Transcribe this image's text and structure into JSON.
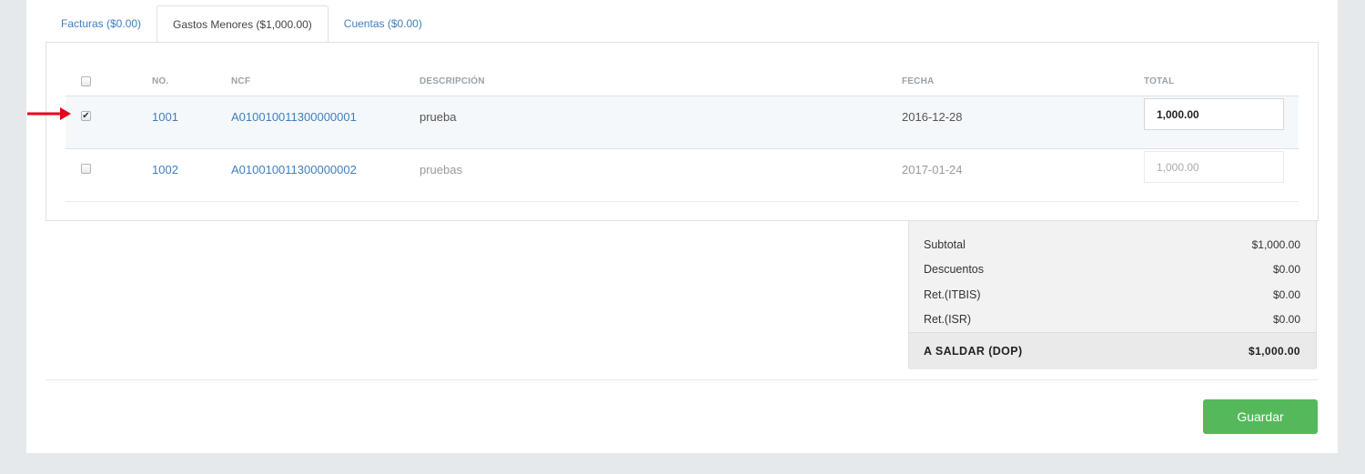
{
  "tabs": [
    {
      "label": "Facturas ($0.00)"
    },
    {
      "label": "Gastos Menores ($1,000.00)"
    },
    {
      "label": "Cuentas ($0.00)"
    }
  ],
  "table": {
    "headers": {
      "no": "NO.",
      "ncf": "NCF",
      "descripcion": "DESCRIPCIÓN",
      "fecha": "FECHA",
      "total": "TOTAL"
    },
    "rows": [
      {
        "checked": true,
        "no": "1001",
        "ncf": "A010010011300000001",
        "descripcion": "prueba",
        "fecha": "2016-12-28",
        "total": "1,000.00"
      },
      {
        "checked": false,
        "no": "1002",
        "ncf": "A010010011300000002",
        "descripcion": "pruebas",
        "fecha": "2017-01-24",
        "total": "1,000.00"
      }
    ]
  },
  "summary": {
    "subtotal_label": "Subtotal",
    "subtotal": "$1,000.00",
    "descuentos_label": "Descuentos",
    "descuentos": "$0.00",
    "ret_itbis_label": "Ret.(ITBIS)",
    "ret_itbis": "$0.00",
    "ret_isr_label": "Ret.(ISR)",
    "ret_isr": "$0.00",
    "a_saldar_label": "A SALDAR (DOP)",
    "a_saldar": "$1,000.00"
  },
  "actions": {
    "save_label": "Guardar"
  },
  "colors": {
    "accent": "#3f7fc1",
    "save": "#55b95c",
    "arrow": "#e8001c"
  },
  "icons": {
    "arrow": "red-arrow-right"
  }
}
